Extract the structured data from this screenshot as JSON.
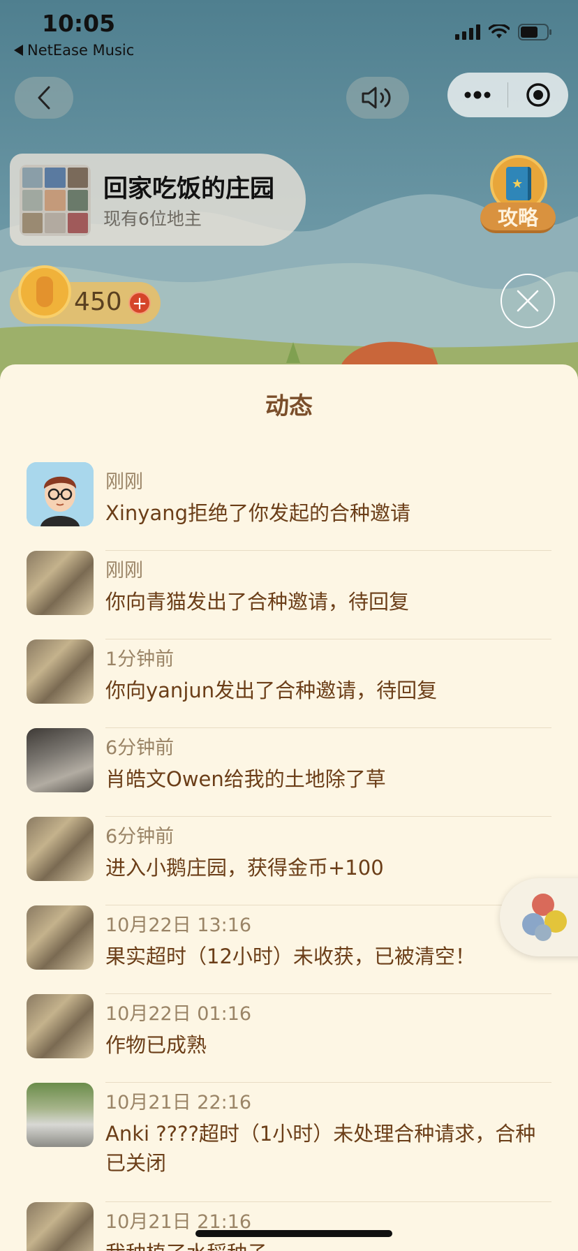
{
  "status_bar": {
    "time": "10:05",
    "back_app": "NetEase Music"
  },
  "farm": {
    "title": "回家吃饭的庄园",
    "subtitle": "现有6位地主"
  },
  "guide": {
    "label": "攻略"
  },
  "coins": {
    "value": "450",
    "add_symbol": "+"
  },
  "sheet": {
    "title": "动态"
  },
  "feed": [
    {
      "time": "刚刚",
      "text": "Xinyang拒绝了你发起的合种邀请",
      "avatar": "cartoon-avatar"
    },
    {
      "time": "刚刚",
      "text": "你向青猫发出了合种邀请，待回复",
      "avatar": "photo-avatar"
    },
    {
      "time": "1分钟前",
      "text": "你向yanjun发出了合种邀请，待回复",
      "avatar": "photo-avatar"
    },
    {
      "time": "6分钟前",
      "text": "肖皓文Owen给我的土地除了草",
      "avatar": "photo-avatar-2"
    },
    {
      "time": "6分钟前",
      "text": "进入小鹅庄园，获得金币+100",
      "avatar": "photo-avatar"
    },
    {
      "time": "10月22日 13:16",
      "text": "果实超时（12小时）未收获，已被清空！",
      "avatar": "photo-avatar"
    },
    {
      "time": "10月22日 01:16",
      "text": "作物已成熟",
      "avatar": "photo-avatar"
    },
    {
      "time": "10月21日 22:16",
      "text": "Anki ????超时（1小时）未处理合种请求，合种已关闭",
      "avatar": "photo-avatar-3"
    },
    {
      "time": "10月21日 21:16",
      "text": "我种植了水稻种子",
      "avatar": "photo-avatar"
    }
  ],
  "colors": {
    "sheet_bg": "#fdf6e4",
    "message_text": "#6b3e18",
    "time_text": "#9a8466",
    "title_text": "#7a4e2a"
  }
}
